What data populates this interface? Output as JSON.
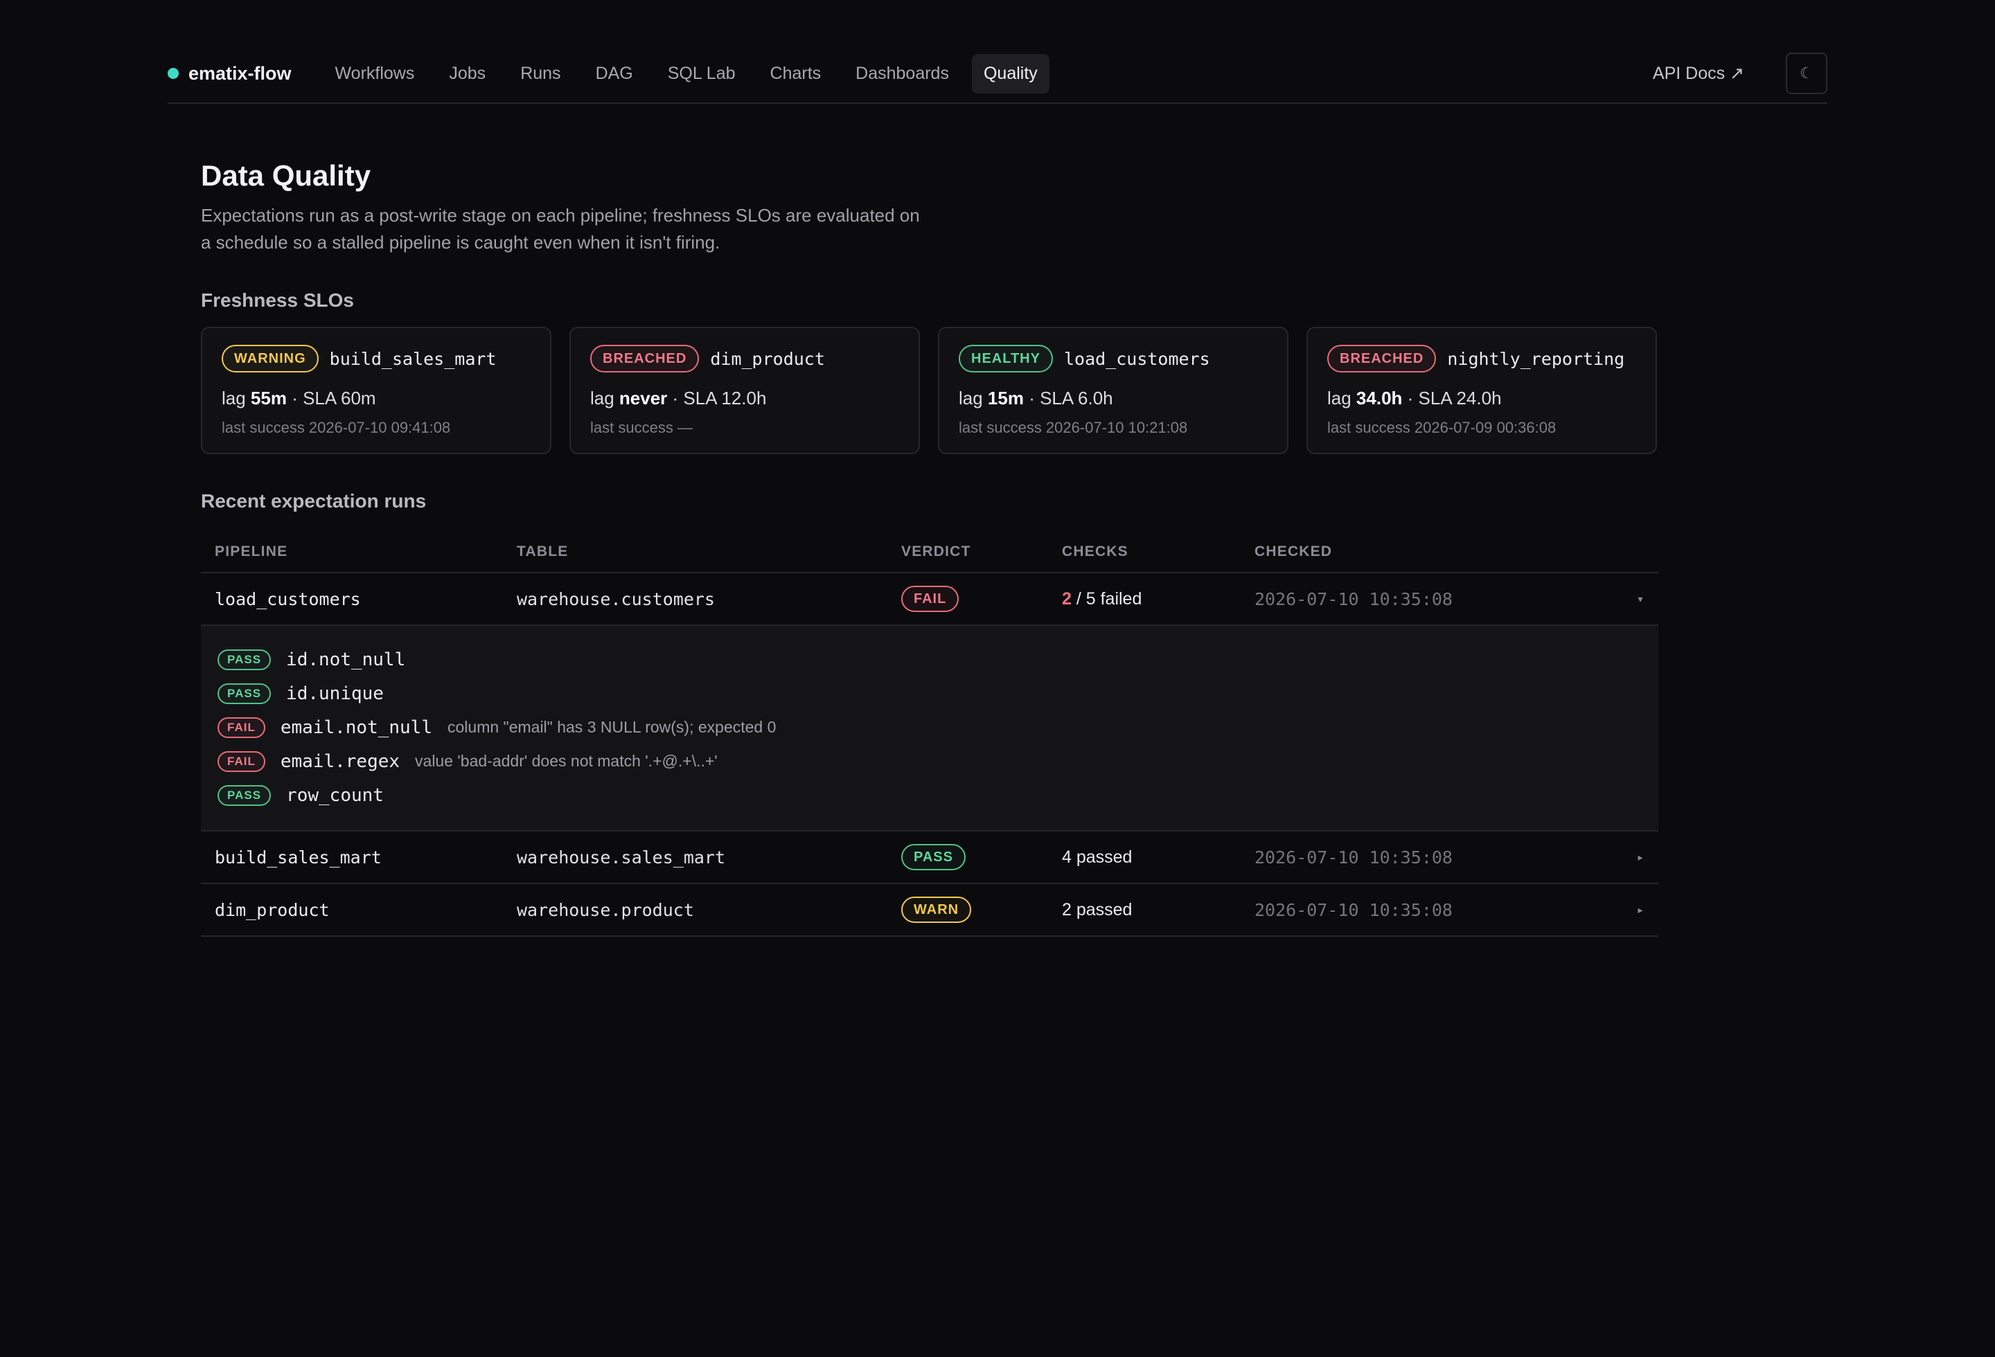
{
  "nav": {
    "brand": "ematix-flow",
    "links": [
      "Workflows",
      "Jobs",
      "Runs",
      "DAG",
      "SQL Lab",
      "Charts",
      "Dashboards",
      "Quality"
    ],
    "active": "Quality",
    "api_docs": "API Docs ↗",
    "theme_toggle": "☾"
  },
  "page": {
    "title": "Data Quality",
    "description_line1": "Expectations run as a post-write stage on each pipeline; freshness SLOs are evaluated on",
    "description_line2": "a schedule so a stalled pipeline is caught even when it isn't firing."
  },
  "slo": {
    "title": "Freshness SLOs",
    "cards": [
      {
        "status": "WARNING",
        "status_kind": "warning",
        "name": "build_sales_mart",
        "lag_prefix": "lag ",
        "lag": "55m",
        "sla": " · SLA 60m",
        "last_success": "last success 2026-07-10 09:41:08"
      },
      {
        "status": "BREACHED",
        "status_kind": "breached",
        "name": "dim_product",
        "lag_prefix": "lag ",
        "lag": "never",
        "sla": " · SLA 12.0h",
        "last_success": "last success —"
      },
      {
        "status": "HEALTHY",
        "status_kind": "healthy",
        "name": "load_customers",
        "lag_prefix": "lag ",
        "lag": "15m",
        "sla": " · SLA 6.0h",
        "last_success": "last success 2026-07-10 10:21:08"
      },
      {
        "status": "BREACHED",
        "status_kind": "breached",
        "name": "nightly_reporting",
        "lag_prefix": "lag ",
        "lag": "34.0h",
        "sla": " · SLA 24.0h",
        "last_success": "last success 2026-07-09 00:36:08"
      }
    ]
  },
  "runs": {
    "title": "Recent expectation runs",
    "headers": {
      "pipeline": "PIPELINE",
      "table": "TABLE",
      "verdict": "VERDICT",
      "checks": "CHECKS",
      "checked": "CHECKED"
    },
    "rows": [
      {
        "pipeline": "load_customers",
        "table": "warehouse.customers",
        "verdict": "FAIL",
        "checks_bad": "2",
        "checks_rest": " / 5 failed",
        "checked": "2026-07-10 10:35:08",
        "caret": "▾"
      },
      {
        "pipeline": "build_sales_mart",
        "table": "warehouse.sales_mart",
        "verdict": "PASS",
        "checks_text": "4 passed",
        "checked": "2026-07-10 10:35:08",
        "caret": "▸"
      },
      {
        "pipeline": "dim_product",
        "table": "warehouse.product",
        "verdict": "WARN",
        "checks_text": "2 passed",
        "checked": "2026-07-10 10:35:08",
        "caret": "▸"
      }
    ],
    "expanded_checks": [
      {
        "result": "PASS",
        "name": "id.not_null",
        "message": ""
      },
      {
        "result": "PASS",
        "name": "id.unique",
        "message": ""
      },
      {
        "result": "FAIL",
        "name": "email.not_null",
        "message": "column \"email\" has 3 NULL row(s); expected 0"
      },
      {
        "result": "FAIL",
        "name": "email.regex",
        "message": "value 'bad-addr' does not match '.+@.+\\..+'"
      },
      {
        "result": "PASS",
        "name": "row_count",
        "message": ""
      }
    ]
  },
  "colors": {
    "background": "#0b0b0d",
    "accent_dot": "#3ddbc3",
    "warning": "#f2c94c",
    "breached": "#e86a7a",
    "healthy": "#4fc287"
  }
}
